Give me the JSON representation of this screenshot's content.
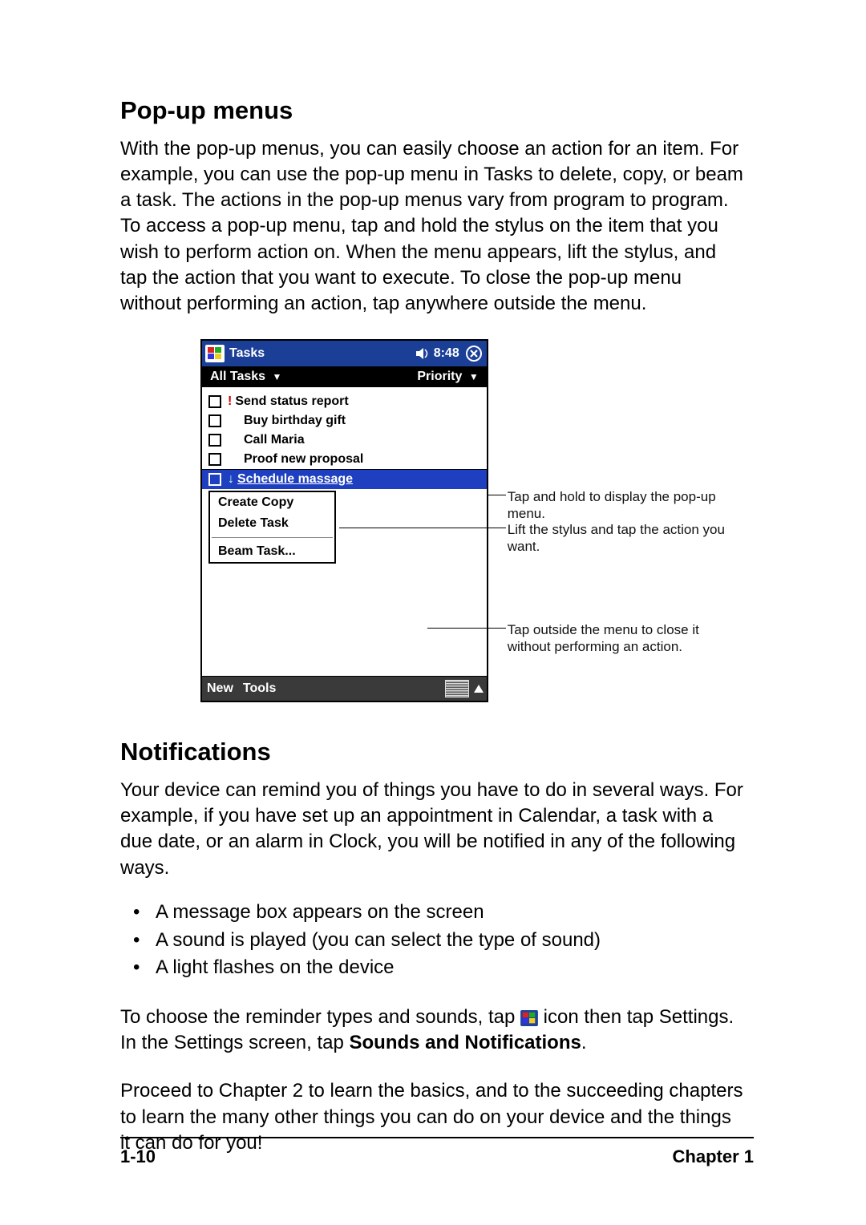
{
  "sections": {
    "popup": {
      "heading": "Pop-up menus",
      "body": "With the pop-up menus, you can easily choose an action for an item. For example, you can use the pop-up menu in Tasks to delete, copy, or beam a task. The actions in the pop-up menus vary from program to program. To access a pop-up menu, tap and hold the stylus on the item that you wish to perform action on. When the menu appears, lift the stylus, and tap the action that you want to execute. To close the pop-up menu without performing an action, tap anywhere outside the menu."
    },
    "notifications": {
      "heading": "Notifications",
      "intro": "Your device can remind you of things you have to do in several ways. For example, if you have set up an appointment in Calendar, a task with a due date, or an alarm in Clock, you will be notified in any of the following ways.",
      "bullets": [
        "A message box appears on the screen",
        "A sound is played (you can select the type of sound)",
        "A light flashes on the device"
      ],
      "para2a": "To choose the reminder types and sounds, tap ",
      "para2b": " icon then tap Settings. In the Settings screen, tap ",
      "para2bold": "Sounds and Notifications",
      "para2c": ".",
      "para3": "Proceed to Chapter 2 to learn the basics, and to the succeeding chapters to learn the many other things you can do on your device and the things it can do for you!"
    }
  },
  "device": {
    "app_title": "Tasks",
    "clock": "8:48",
    "filter_left": "All Tasks",
    "filter_right": "Priority",
    "tasks": [
      {
        "label": "Send status report",
        "priority": "high"
      },
      {
        "label": "Buy birthday gift"
      },
      {
        "label": "Call Maria"
      },
      {
        "label": "Proof new proposal"
      },
      {
        "label": "Schedule massage",
        "priority": "low",
        "selected": true
      }
    ],
    "menu": [
      "Create Copy",
      "Delete Task",
      "---",
      "Beam Task..."
    ],
    "bottom_left": "New",
    "bottom_left2": "Tools"
  },
  "callouts": {
    "a": "Tap and hold to display the pop-up menu.",
    "b": "Lift the stylus and tap the action you want.",
    "c": "Tap outside the menu to close it without performing an action."
  },
  "footer": {
    "left": "1-10",
    "right": "Chapter 1"
  }
}
